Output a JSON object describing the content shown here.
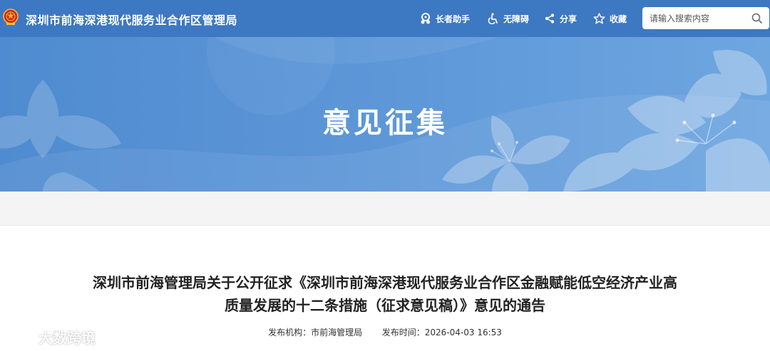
{
  "header": {
    "site_title": "深圳市前海深港现代服务业合作区管理局",
    "tools": [
      {
        "label": "长者助手",
        "icon": "elder-assistant-icon"
      },
      {
        "label": "无障碍",
        "icon": "accessibility-icon"
      },
      {
        "label": "分享",
        "icon": "share-icon"
      },
      {
        "label": "收藏",
        "icon": "star-icon"
      }
    ],
    "search": {
      "placeholder": "请输入搜索内容",
      "icon": "search-icon"
    }
  },
  "banner": {
    "title": "意见征集"
  },
  "article": {
    "title_line1": "深圳市前海管理局关于公开征求《深圳市前海深港现代服务业合作区金融赋能低空经济产业高",
    "title_line2": "质量发展的十二条措施（征求意见稿）》意见的通告",
    "publisher_label": "发布机构：",
    "publisher": "市前海管理局",
    "time_label": "发布时间：",
    "time": "2026-04-03 16:53"
  },
  "watermark": {
    "text": "大数跨境"
  },
  "colors": {
    "header_bg": "#3d78c2",
    "banner_bg": "#5d97d8",
    "accent": "#ffffff"
  }
}
